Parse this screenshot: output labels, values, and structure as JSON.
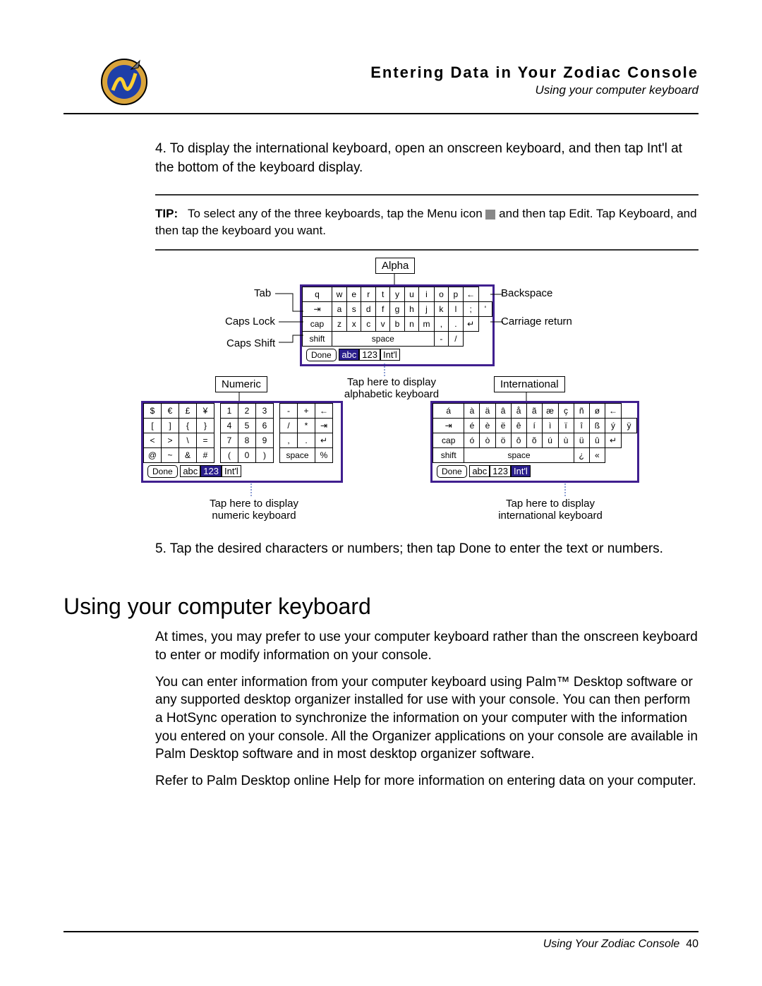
{
  "header": {
    "title": "Entering Data in Your Zodiac Console",
    "sub": "Using your computer keyboard"
  },
  "step4": {
    "num": "4.",
    "text": "To display the international keyboard, open an onscreen keyboard, and then tap Int'l at the bottom of the keyboard display."
  },
  "tip": {
    "label": "TIP:",
    "text1": "To select any of the three keyboards, tap the Menu icon",
    "text2": "and then tap Edit. Tap Keyboard, and then tap the keyboard you want."
  },
  "labels": {
    "alpha": "Alpha",
    "numeric": "Numeric",
    "international": "International",
    "tab": "Tab",
    "capslock": "Caps Lock",
    "capsshift": "Caps Shift",
    "backspace": "Backspace",
    "carriage": "Carriage return",
    "tap_alpha": "Tap here to display alphabetic keyboard",
    "tap_numeric": "Tap here to display numeric keyboard",
    "tap_intl": "Tap here to display international keyboard"
  },
  "kbd_alpha": {
    "row1": [
      "q",
      "w",
      "e",
      "r",
      "t",
      "y",
      "u",
      "i",
      "o",
      "p",
      "←"
    ],
    "row2": [
      "⇥",
      "a",
      "s",
      "d",
      "f",
      "g",
      "h",
      "j",
      "k",
      "l",
      ";",
      "'"
    ],
    "row3": [
      "cap",
      "z",
      "x",
      "c",
      "v",
      "b",
      "n",
      "m",
      ",",
      ".",
      "↵"
    ],
    "row4": [
      "shift",
      "space",
      "-",
      "/"
    ],
    "modes": [
      "Done",
      "abc",
      "123",
      "Int'l"
    ],
    "sel": "abc"
  },
  "kbd_num": {
    "left": [
      [
        "$",
        "€",
        "£",
        "¥"
      ],
      [
        "[",
        "]",
        "{",
        "}"
      ],
      [
        "<",
        ">",
        "\\",
        "="
      ],
      [
        "@",
        "~",
        "&",
        "#"
      ]
    ],
    "mid": [
      [
        "1",
        "2",
        "3"
      ],
      [
        "4",
        "5",
        "6"
      ],
      [
        "7",
        "8",
        "9"
      ],
      [
        "(",
        "0",
        ")"
      ]
    ],
    "right": [
      [
        "-",
        "+",
        "←"
      ],
      [
        "/",
        "*",
        "⇥"
      ],
      [
        ",",
        ".",
        "↵"
      ],
      [
        "space",
        "%"
      ]
    ],
    "modes": [
      "Done",
      "abc",
      "123",
      "Int'l"
    ],
    "sel": "123"
  },
  "kbd_intl": {
    "row1": [
      "á",
      "à",
      "ä",
      "â",
      "å",
      "ã",
      "æ",
      "ç",
      "ñ",
      "ø",
      "←"
    ],
    "row2": [
      "⇥",
      "é",
      "è",
      "ë",
      "ê",
      "í",
      "ì",
      "ï",
      "î",
      "ß",
      "ý",
      "ÿ"
    ],
    "row3": [
      "cap",
      "ó",
      "ò",
      "ö",
      "ô",
      "õ",
      "ú",
      "ù",
      "ü",
      "û",
      "↵"
    ],
    "row4": [
      "shift",
      "space",
      "¿",
      "«"
    ],
    "modes": [
      "Done",
      "abc",
      "123",
      "Int'l"
    ],
    "sel": "Int'l"
  },
  "step5": {
    "num": "5.",
    "text": "Tap the desired characters or numbers; then tap Done to enter the text or numbers."
  },
  "section_title": "Using your computer keyboard",
  "para1": "At times, you may prefer to use your computer keyboard rather than the onscreen keyboard to enter or modify information on your console.",
  "para2": "You can enter information from your computer keyboard using Palm™ Desktop software or any supported desktop organizer installed for use with your console. You can then perform a HotSync operation to synchronize the information on your computer with the information you entered on your console. All the Organizer applications on your console are available in Palm Desktop software and in most desktop organizer software.",
  "para3": "Refer to Palm Desktop online Help for more information on entering data on your computer.",
  "footer": {
    "text": "Using Your Zodiac Console",
    "page": "40"
  }
}
